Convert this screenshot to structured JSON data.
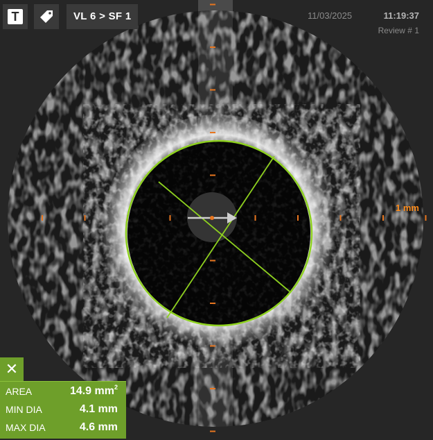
{
  "toolbar": {
    "text_tool_glyph": "T",
    "text_tool_icon": "text-tool-icon",
    "tag_tool_icon": "tag-icon",
    "breadcrumb": "VL 6 > SF 1"
  },
  "header": {
    "date": "11/03/2025",
    "time": "11:19:37",
    "review": "Review # 1"
  },
  "scale": {
    "label": "1 mm",
    "marker_color": "#e8761f"
  },
  "measurement": {
    "close_label": "✕",
    "area_label": "AREA",
    "area_value": "14.9 mm",
    "area_unit_sup": "2",
    "min_dia_label": "MIN DIA",
    "min_dia_value": "4.1 mm",
    "max_dia_label": "MAX DIA",
    "max_dia_value": "4.6 mm",
    "contour_color": "#8ed11f",
    "panel_color": "#6e9f2a"
  }
}
